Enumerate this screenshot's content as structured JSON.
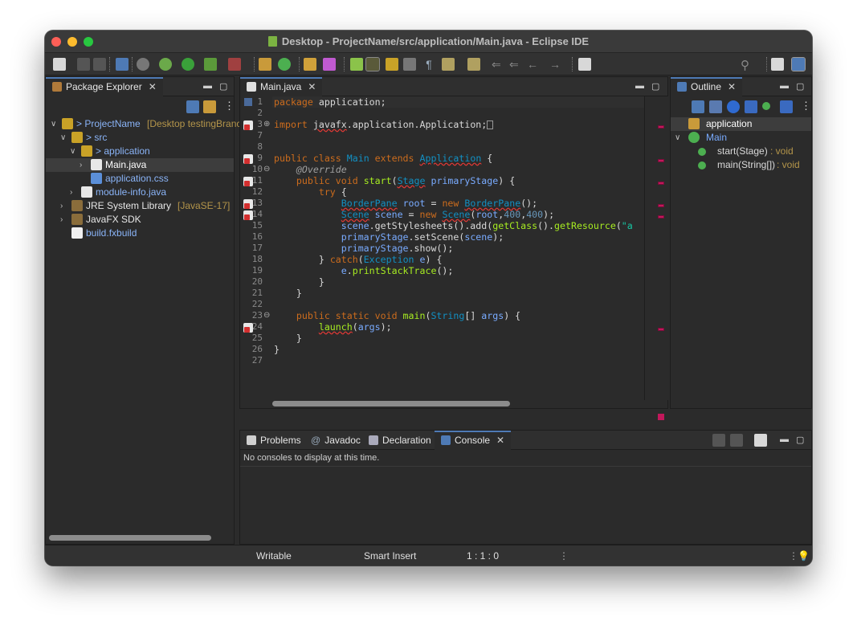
{
  "window": {
    "title": "Desktop - ProjectName/src/application/Main.java - Eclipse IDE"
  },
  "colors": {
    "red": "#fe5f57",
    "yellow": "#febc2e",
    "green": "#28c840",
    "accent": "#4e7ab5",
    "error": "#d32f2f"
  },
  "package_explorer": {
    "tab_label": "Package Explorer",
    "tree": [
      {
        "label": "> ProjectName",
        "decoration": "[Desktop testingBranc",
        "level": 0,
        "icon": "project-icon"
      },
      {
        "label": "> src",
        "decoration": "",
        "level": 1,
        "icon": "package-folder-icon"
      },
      {
        "label": "> application",
        "decoration": "",
        "level": 2,
        "icon": "package-icon"
      },
      {
        "label": "Main.java",
        "decoration": "",
        "level": 3,
        "icon": "java-file-icon"
      },
      {
        "label": "application.css",
        "decoration": "",
        "level": 3,
        "icon": "css-file-icon"
      },
      {
        "label": "module-info.java",
        "decoration": "",
        "level": 2,
        "icon": "java-file-icon"
      },
      {
        "label": "JRE System Library",
        "decoration": "[JavaSE-17]",
        "level": 1,
        "icon": "library-icon"
      },
      {
        "label": "JavaFX SDK",
        "decoration": "",
        "level": 1,
        "icon": "library-icon"
      },
      {
        "label": "build.fxbuild",
        "decoration": "",
        "level": 1,
        "icon": "fxbuild-file-icon"
      }
    ]
  },
  "editor": {
    "tab_label": "Main.java",
    "line_numbers": [
      "1",
      "2",
      "3",
      "7",
      "8",
      "9",
      "10",
      "11",
      "12",
      "13",
      "14",
      "15",
      "16",
      "17",
      "18",
      "19",
      "20",
      "21",
      "22",
      "23",
      "24",
      "25",
      "26",
      "27"
    ]
  },
  "outline": {
    "tab_label": "Outline",
    "items": [
      {
        "label": "application",
        "type": ""
      },
      {
        "label": "Main",
        "type": ""
      },
      {
        "label": "start(Stage)",
        "type": " : void"
      },
      {
        "label": "main(String[])",
        "type": " : void"
      }
    ]
  },
  "bottom": {
    "tabs": [
      "Problems",
      "Javadoc",
      "Declaration",
      "Console"
    ],
    "console_message": "No consoles to display at this time."
  },
  "status": {
    "writable": "Writable",
    "insert_mode": "Smart Insert",
    "position": "1 : 1 : 0"
  }
}
